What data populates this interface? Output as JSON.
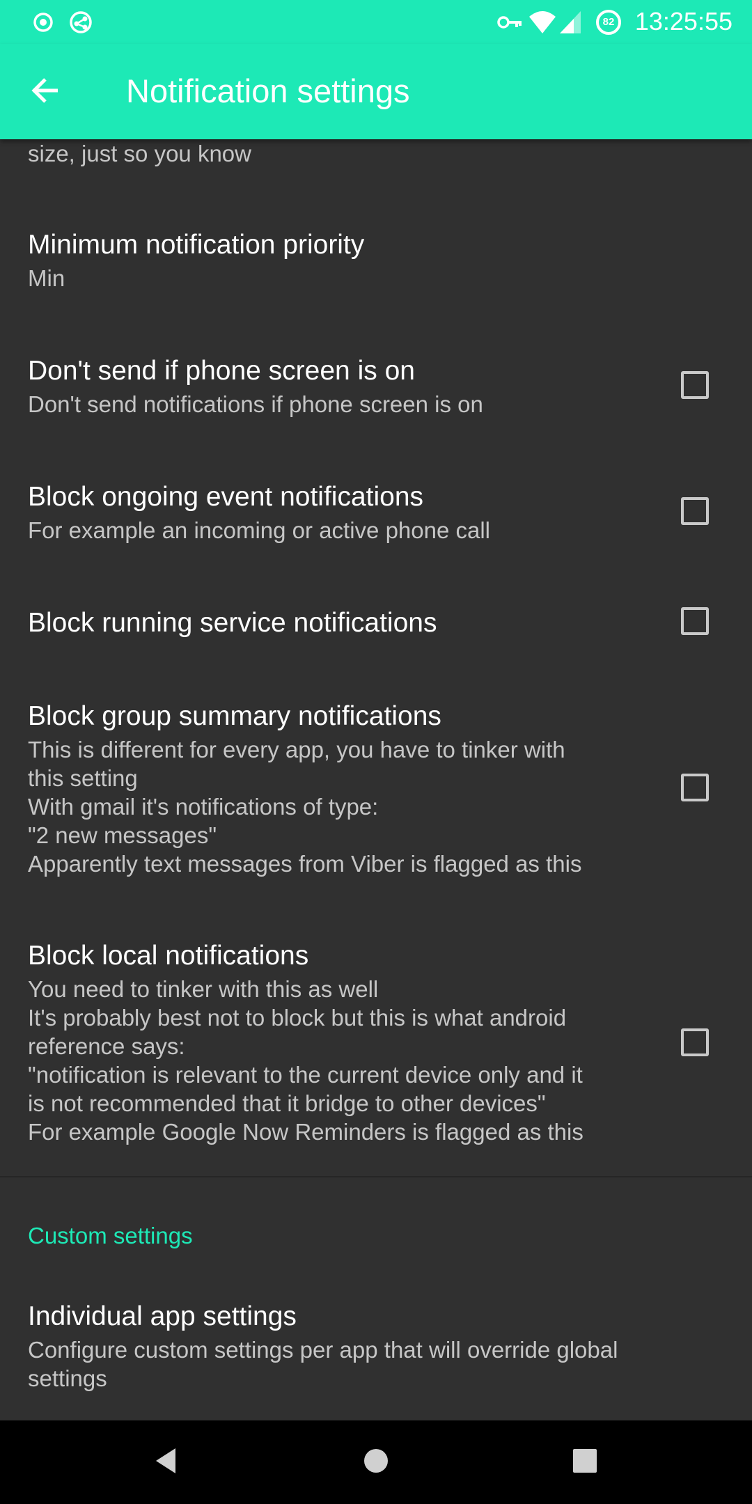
{
  "status_bar": {
    "time": "13:25:55",
    "battery_level": "82",
    "left_icons": [
      "record-icon",
      "share-network-icon"
    ],
    "right_icons": [
      "vpn-key-icon",
      "wifi-icon",
      "cell-signal-icon",
      "battery-icon"
    ]
  },
  "app_bar": {
    "title": "Notification settings",
    "back_icon": "arrow-back-icon"
  },
  "content": {
    "cut_text": "size, just so you know",
    "prefs": [
      {
        "title": "Minimum notification priority",
        "summary": "Min"
      },
      {
        "title": "Don't send if phone screen is on",
        "summary": "Don't send notifications if phone screen is on",
        "checked": false
      },
      {
        "title": "Block ongoing event notifications",
        "summary": "For example an incoming or active phone call",
        "checked": false
      },
      {
        "title": "Block running service notifications",
        "checked": false
      },
      {
        "title": "Block group summary notifications",
        "summary": "This is different for every app, you have to tinker with\nthis setting\nWith gmail it's notifications of type:\n\"2 new messages\"\nApparently text messages from Viber is flagged as this",
        "checked": false
      },
      {
        "title": "Block local notifications",
        "summary": "You need to tinker with this as well\nIt's probably best not to block but this is what android\nreference says:\n\"notification is relevant to the current device only and it\nis not recommended that it bridge to other devices\"\nFor example Google Now Reminders is flagged as this",
        "checked": false
      }
    ],
    "category": "Custom settings",
    "custom_prefs": [
      {
        "title": "Individual app settings",
        "summary": "Configure custom settings per app that will override global\nsettings"
      }
    ]
  },
  "nav_bar": {
    "buttons": [
      "back-triangle-icon",
      "home-circle-icon",
      "recents-square-icon"
    ]
  },
  "colors": {
    "accent": "#1de9b6",
    "background": "#303030",
    "text_primary": "#ffffff",
    "text_secondary": "#c6c6c6"
  }
}
